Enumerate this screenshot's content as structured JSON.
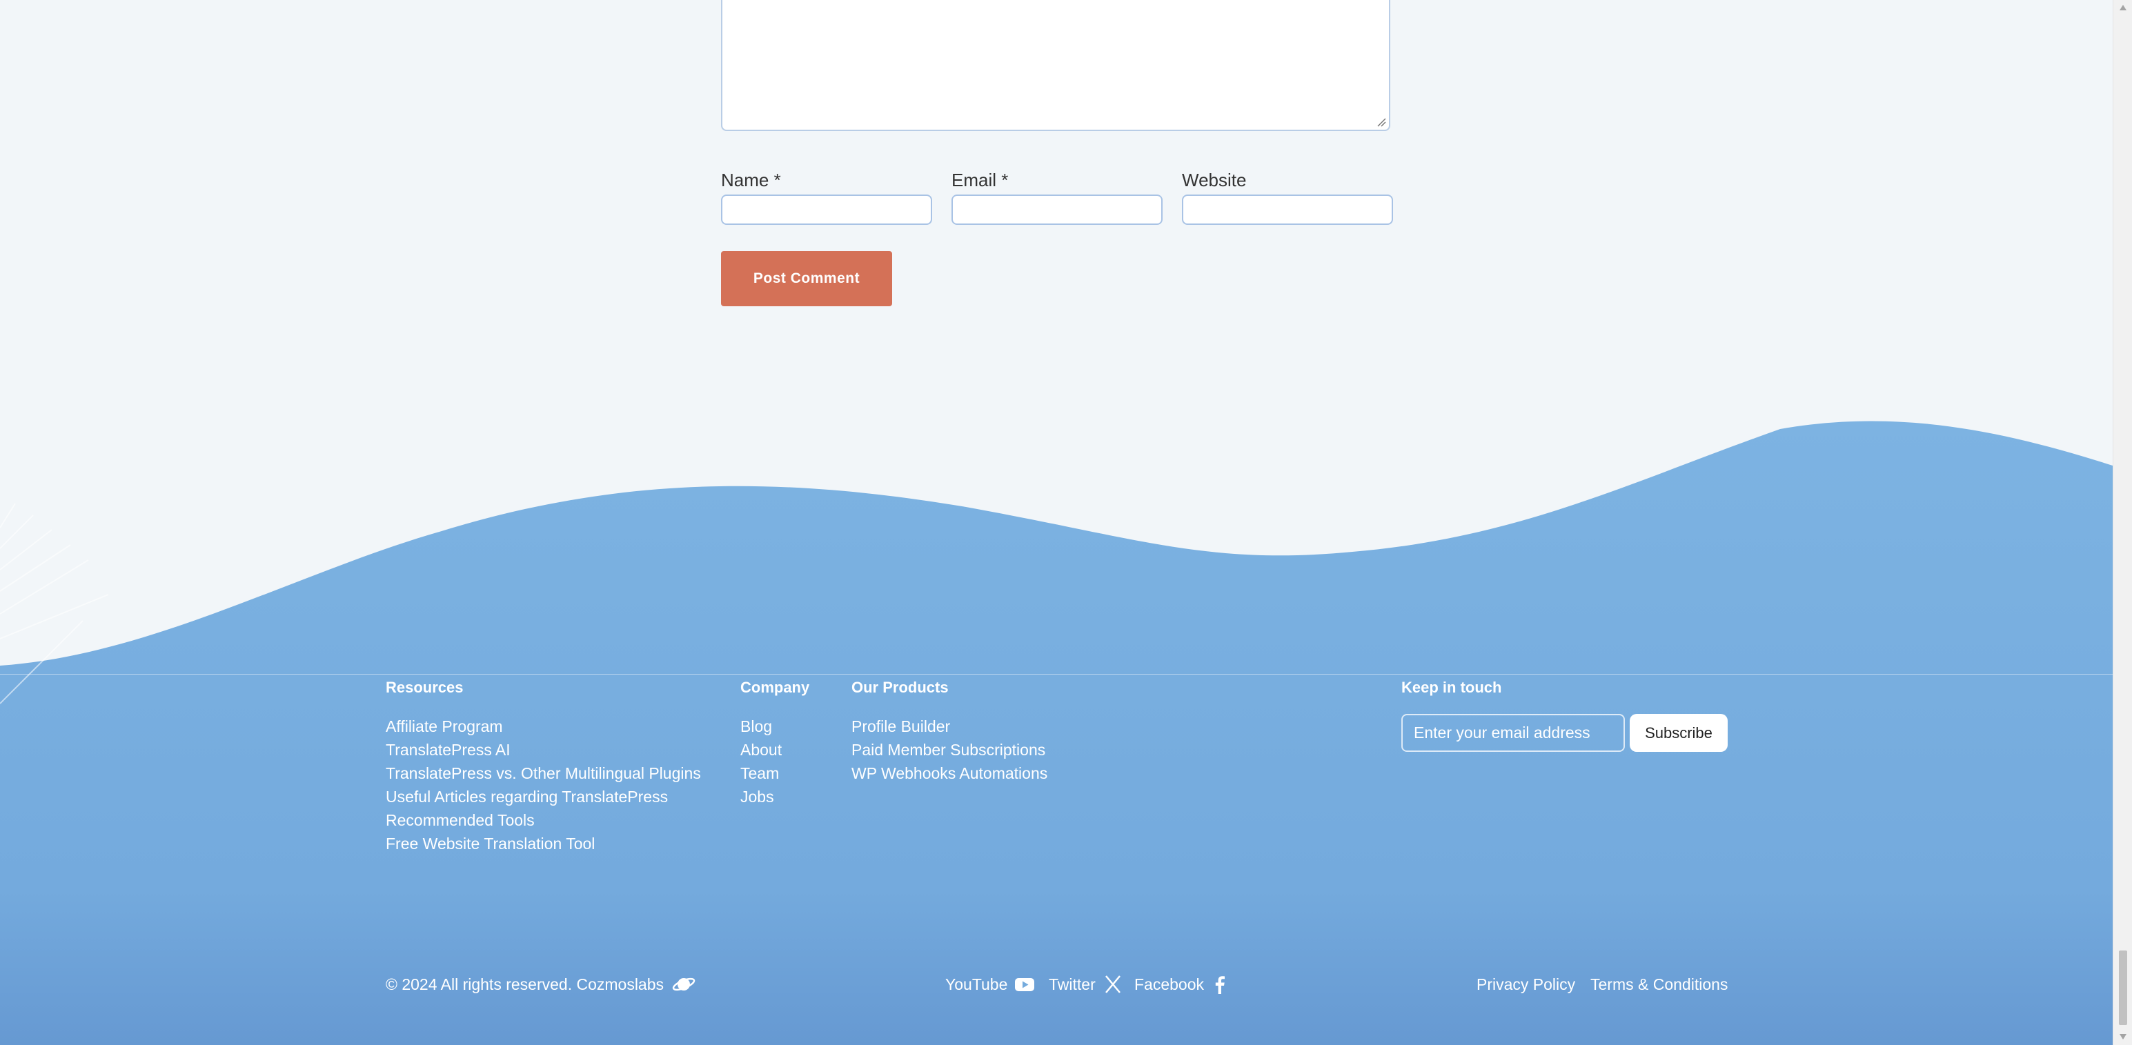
{
  "comment_form": {
    "name_label": "Name *",
    "email_label": "Email *",
    "website_label": "Website",
    "submit_label": "Post Comment"
  },
  "footer": {
    "resources": {
      "title": "Resources",
      "items": [
        "Affiliate Program",
        "TranslatePress AI",
        "TranslatePress vs. Other Multilingual Plugins",
        "Useful Articles regarding TranslatePress",
        "Recommended Tools",
        "Free Website Translation Tool"
      ]
    },
    "company": {
      "title": "Company",
      "items": [
        "Blog",
        "About",
        "Team",
        "Jobs"
      ]
    },
    "products": {
      "title": "Our Products",
      "items": [
        "Profile Builder",
        "Paid Member Subscriptions",
        "WP Webhooks Automations"
      ]
    },
    "newsletter": {
      "title": "Keep in touch",
      "placeholder": "Enter your email address",
      "button_label": "Subscribe"
    },
    "copyright": "© 2024 All rights reserved. Cozmoslabs",
    "social": {
      "youtube": "YouTube",
      "twitter": "Twitter",
      "facebook": "Facebook"
    },
    "legal": {
      "privacy": "Privacy Policy",
      "terms": "Terms & Conditions"
    }
  },
  "colors": {
    "page_background": "#f2f6f9",
    "footer_blue": "#7ab1e1",
    "button_orange": "#d47157",
    "input_border": "#a9c3e5"
  },
  "icons": [
    "planet-icon",
    "youtube-icon",
    "x-twitter-icon",
    "facebook-icon",
    "resize-grip-icon"
  ]
}
